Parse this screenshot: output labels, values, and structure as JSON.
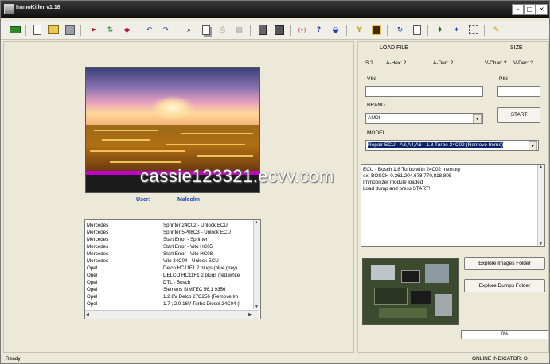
{
  "window": {
    "title": "ImmoKiller v1.18"
  },
  "toolbar": {
    "icons": [
      "green-rect-icon",
      "new-file-icon",
      "open-folder-icon",
      "save-disk-icon",
      "load-red-icon",
      "up-down-arrows-icon",
      "read-red-icon",
      "undo-icon",
      "redo-icon",
      "find-icon",
      "copy-icon",
      "print-icon",
      "paste-icon",
      "calculator-icon",
      "checksum-icon",
      "hex-icon",
      "help-icon",
      "eye-icon",
      "filter-icon",
      "chip-icon",
      "refresh-icon",
      "page-icon",
      "pin-icon",
      "compare-icon",
      "pen-icon"
    ]
  },
  "header": {
    "load_file": "LOAD FILE",
    "size": "SIZE",
    "s_label": "S ?",
    "a_hex": "A-Hex: ?",
    "a_dec": "A-Dec: ?",
    "v_char": "V-Char: ?",
    "v_dec": "V-Dec: ?"
  },
  "form": {
    "vin_label": "VIN",
    "vin_value": "",
    "pin_label": "PIN",
    "pin_value": "",
    "brand_label": "BRAND",
    "brand_value": "AUDI",
    "model_label": "MODEL",
    "model_value": "Repair ECU - A3,A4,A6 - 1.8 Turbo 24C02 (Remove Immo)",
    "start_label": "START"
  },
  "log": [
    "ECU - Bosch 1.8 Turbo with 24C02 memory",
    "ex. BOSCH  0.261.204.678,770,818,805",
    "Immobilizer module loaded",
    "Load dump and press START!"
  ],
  "user": {
    "label": "User:",
    "name": "Malcolm"
  },
  "list": [
    {
      "brand": "Mercedes",
      "model": "Sprinter 24C02 - Unlock ECU"
    },
    {
      "brand": "Mercedes",
      "model": "Sprinter 5P08C3 - Unlock ECU"
    },
    {
      "brand": "Mercedes",
      "model": "Start Error - Sprinter"
    },
    {
      "brand": "Mercedes",
      "model": "Start Error - Vito HC05"
    },
    {
      "brand": "Mercedes",
      "model": "Start Error - Vito HC08"
    },
    {
      "brand": "Mercedes",
      "model": "Vito 24C04        - Unlock ECU"
    },
    {
      "brand": "Opel",
      "model": "Delco HC11F1 2 plugs (blue,grey)"
    },
    {
      "brand": "Opel",
      "model": "DELCO HC11F1 2 plugs (red,white"
    },
    {
      "brand": "Opel",
      "model": "DTL - Bosch"
    },
    {
      "brand": "Opel",
      "model": "Siemens SIMTEC 56.1 9356"
    },
    {
      "brand": "Opel",
      "model": "1.2 8V Delco 27C256 (Remove Im"
    },
    {
      "brand": "Opel",
      "model": "1.7 ; 2.0 16V Turbo Diesel 24C04 (I"
    }
  ],
  "buttons": {
    "explore_images": "Explore Images Folder",
    "explore_dumps": "Explore Dumps Folder"
  },
  "size_indicator": "0%",
  "status": {
    "left": "Ready",
    "right": "ONLINE INDICATOR:  O"
  },
  "watermark": "cassie123321.ecvv.com",
  "colors": {
    "selection": "#0a246a",
    "user_text": "#1b3fb5",
    "purple_bar": "#c000c8"
  }
}
